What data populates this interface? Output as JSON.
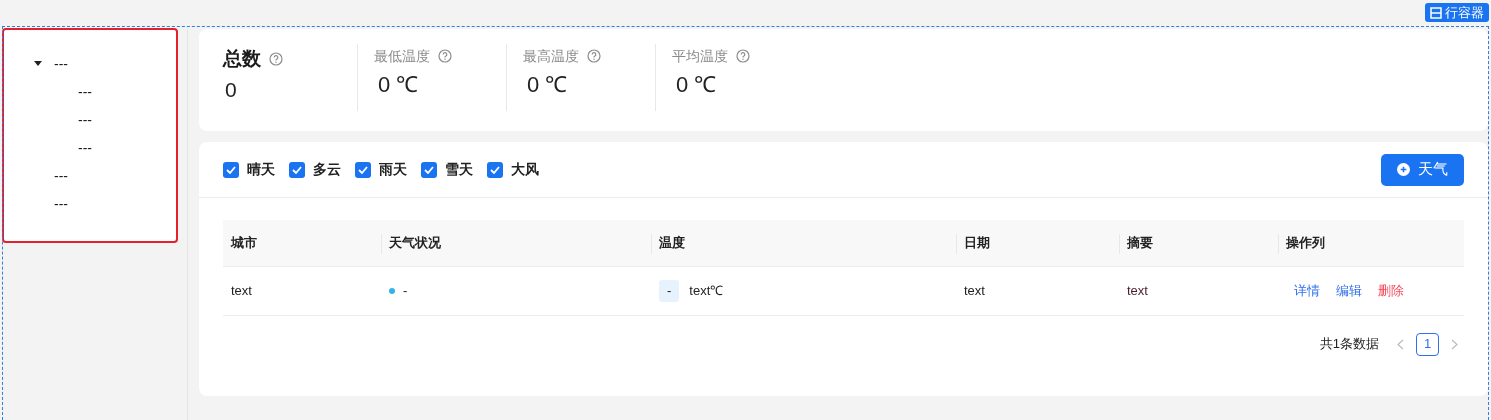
{
  "container_badge": {
    "label": "行容器"
  },
  "tree": [
    {
      "label": "---",
      "expanded": true,
      "children": [
        {
          "label": "---"
        },
        {
          "label": "---"
        },
        {
          "label": "---"
        }
      ]
    },
    {
      "label": "---"
    },
    {
      "label": "---"
    }
  ],
  "stats": [
    {
      "kind": "total",
      "label": "总数",
      "value": "0"
    },
    {
      "kind": "metric",
      "label": "最低温度",
      "value": "0 ℃"
    },
    {
      "kind": "metric",
      "label": "最高温度",
      "value": "0 ℃"
    },
    {
      "kind": "metric",
      "label": "平均温度",
      "value": "0 ℃"
    }
  ],
  "filters": [
    {
      "label": "晴天",
      "checked": true
    },
    {
      "label": "多云",
      "checked": true
    },
    {
      "label": "雨天",
      "checked": true
    },
    {
      "label": "雪天",
      "checked": true
    },
    {
      "label": "大风",
      "checked": true
    }
  ],
  "add_button": {
    "label": "天气"
  },
  "table": {
    "columns": [
      "城市",
      "天气状况",
      "温度",
      "日期",
      "摘要",
      "操作列"
    ],
    "rows": [
      {
        "city": "text",
        "status": {
          "label": "-",
          "color": "#36b3ec"
        },
        "temperature": {
          "tag": "-",
          "value": "text℃"
        },
        "date": "text",
        "summary": "text",
        "actions": [
          {
            "label": "详情",
            "kind": "primary"
          },
          {
            "label": "编辑",
            "kind": "primary"
          },
          {
            "label": "删除",
            "kind": "danger"
          }
        ]
      }
    ]
  },
  "pagination": {
    "total": "共1条数据",
    "pages": [
      {
        "label": "1",
        "selected": true
      }
    ]
  }
}
